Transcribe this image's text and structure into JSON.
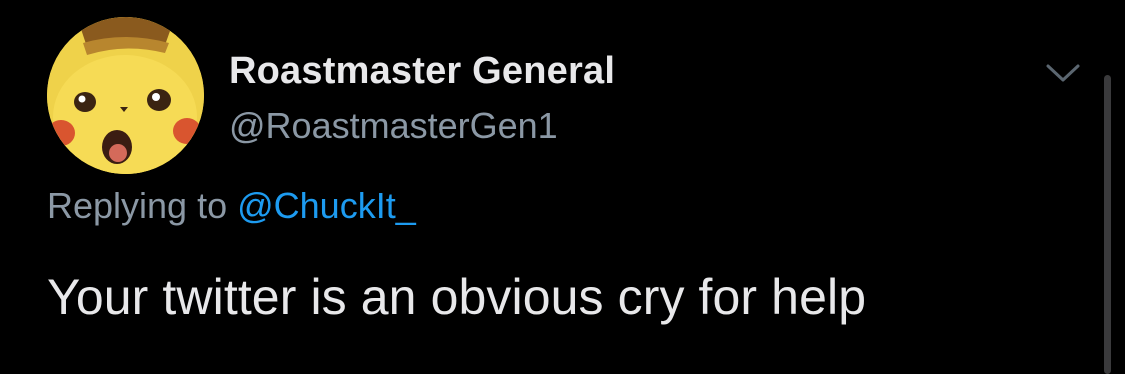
{
  "tweet": {
    "author": {
      "display_name": "Roastmaster General",
      "handle": "@RoastmasterGen1",
      "avatar_icon": "surprised-pikachu-avatar"
    },
    "replying_to": {
      "prefix": "Replying to",
      "mention": "@ChuckIt_"
    },
    "text": "Your twitter is an obvious cry for help",
    "menu_icon": "chevron-down-icon"
  },
  "colors": {
    "background": "#000000",
    "primary_text": "#e8e8ea",
    "secondary_text": "#8b98a5",
    "mention": "#1d9bf0",
    "avatar_yellow": "#f0d64a"
  }
}
